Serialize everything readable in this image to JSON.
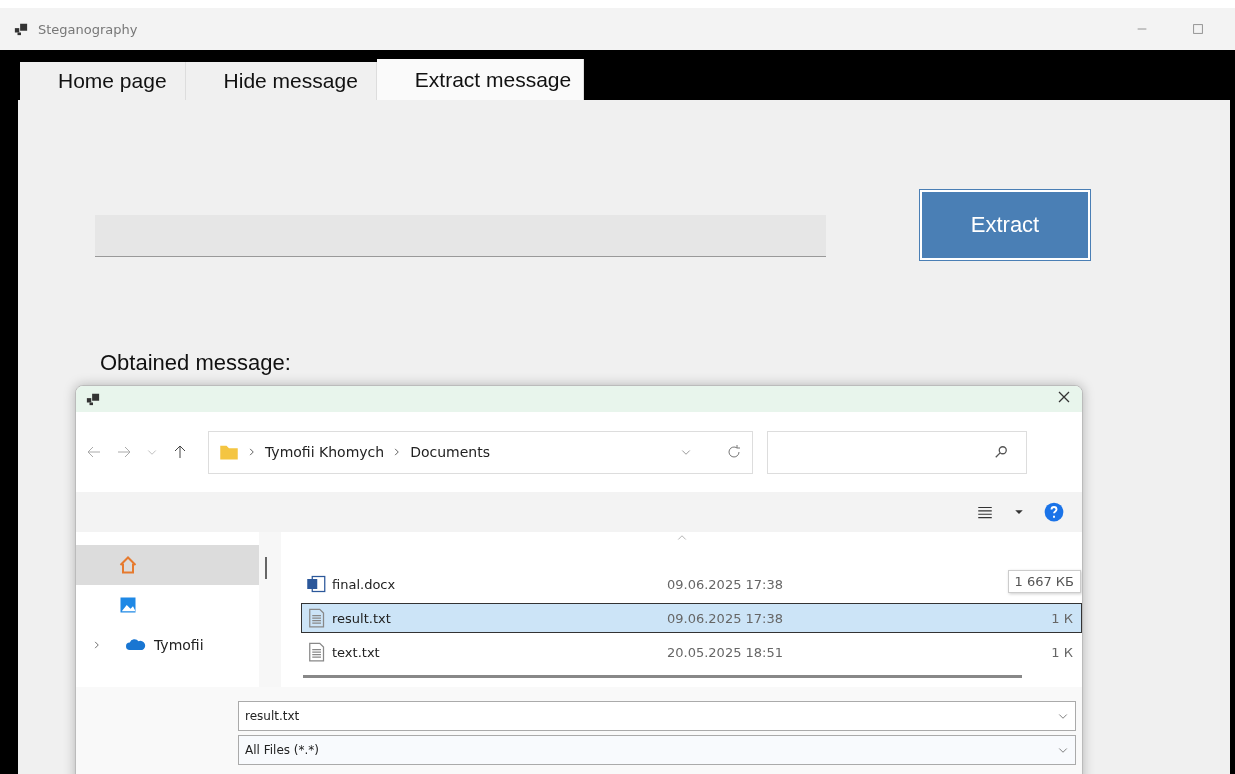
{
  "window": {
    "title": "Steganography"
  },
  "tabs": [
    {
      "label": "Home page",
      "selected": false
    },
    {
      "label": "Hide message",
      "selected": false
    },
    {
      "label": "Extract message",
      "selected": true
    }
  ],
  "extract_button": "Extract",
  "obtained_label": "Obtained message:",
  "dialog": {
    "address": [
      "Tymofii Khomych",
      "Documents"
    ],
    "sidebar": [
      {
        "kind": "home",
        "selected": true
      },
      {
        "kind": "pictures",
        "selected": false
      },
      {
        "kind": "cloud",
        "label": "Tymofii",
        "selected": false
      }
    ],
    "files": [
      {
        "kind": "word",
        "name": "final.docx",
        "date": "09.06.2025 17:38",
        "size": "1 667 КБ",
        "tooltip": true,
        "selected": false
      },
      {
        "kind": "text",
        "name": "result.txt",
        "date": "09.06.2025 17:38",
        "size": "1 К",
        "tooltip": false,
        "selected": true
      },
      {
        "kind": "text",
        "name": "text.txt",
        "date": "20.05.2025 18:51",
        "size": "1 К",
        "tooltip": false,
        "selected": false
      }
    ],
    "file_name": "result.txt",
    "file_type": "All Files (*.*)"
  }
}
